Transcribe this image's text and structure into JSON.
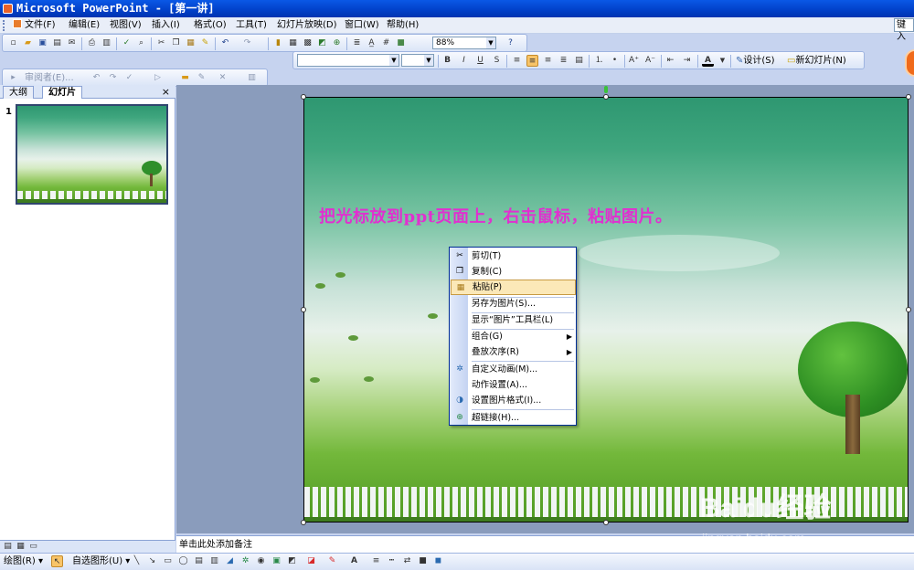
{
  "window": {
    "title": "Microsoft PowerPoint - [第一讲]"
  },
  "menubar": {
    "items": [
      "文件(F)",
      "编辑(E)",
      "视图(V)",
      "插入(I)",
      "格式(O)",
      "工具(T)",
      "幻灯片放映(D)",
      "窗口(W)",
      "帮助(H)"
    ],
    "help_box": "键入"
  },
  "standard_toolbar": {
    "zoom": "88%"
  },
  "formatting_toolbar": {
    "font_name": "",
    "font_size": "",
    "bold": "B",
    "italic": "I",
    "underline": "U",
    "shadow": "S",
    "font_color_glyph": "A",
    "design_label": "设计(S)",
    "new_slide_label": "新幻灯片(N)"
  },
  "review_toolbar": {
    "reviewer_label": "审阅者(E)..."
  },
  "outline_pane": {
    "tabs": [
      "大纲",
      "幻灯片"
    ],
    "active_tab": "幻灯片",
    "close": "×",
    "slide_number": "1"
  },
  "slide": {
    "caption": "把光标放到ppt页面上，右击鼠标，粘贴图片。",
    "caption_color": "#e030d0"
  },
  "context_menu": {
    "items": [
      {
        "label": "剪切(T)",
        "icon": "scissors-icon"
      },
      {
        "label": "复制(C)",
        "icon": "copy-icon"
      },
      {
        "label": "粘贴(P)",
        "icon": "paste-icon",
        "highlighted": true
      },
      {
        "label": "另存为图片(S)...",
        "icon": ""
      },
      {
        "label": "显示“图片”工具栏(L)",
        "icon": ""
      },
      {
        "label": "组合(G)",
        "icon": "",
        "submenu": true
      },
      {
        "label": "叠放次序(R)",
        "icon": "",
        "submenu": true
      },
      {
        "label": "自定义动画(M)...",
        "icon": "animation-icon"
      },
      {
        "label": "动作设置(A)...",
        "icon": ""
      },
      {
        "label": "设置图片格式(I)...",
        "icon": "format-picture-icon"
      },
      {
        "label": "超链接(H)...",
        "icon": "hyperlink-icon"
      }
    ]
  },
  "notes": {
    "placeholder": "单击此处添加备注"
  },
  "drawing_toolbar": {
    "draw_label": "绘图(R)",
    "autoshapes_label": "自选图形(U)"
  },
  "watermark": {
    "brand": "Baidu",
    "brand_suffix": "经验",
    "url": "jingyan.baidu.com"
  }
}
